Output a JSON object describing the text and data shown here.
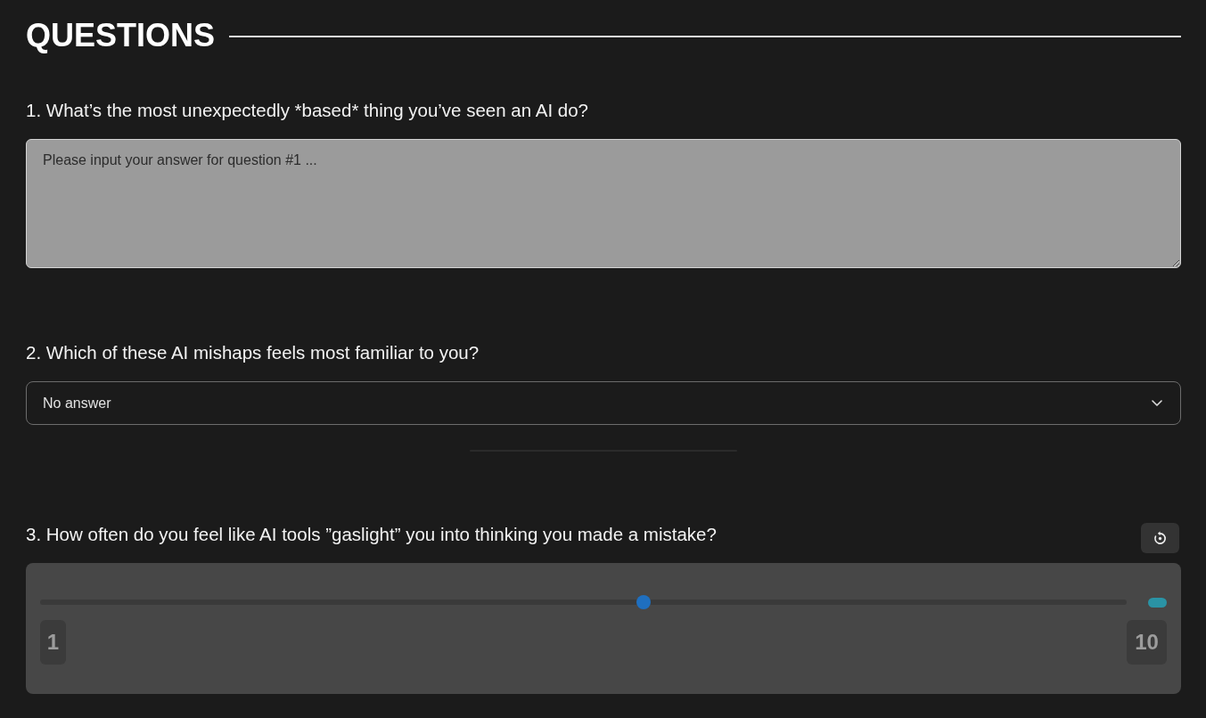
{
  "heading": "QUESTIONS",
  "questions": [
    {
      "kind": "text",
      "label": "1. What’s the most unexpectedly *based* thing you’ve seen an AI do?",
      "placeholder": "Please input your answer for question #1 ..."
    },
    {
      "kind": "select",
      "label": "2. Which of these AI mishaps feels most familiar to you?",
      "value": "No answer"
    },
    {
      "kind": "slider",
      "label": "3. How often do you feel like AI tools ”gaslight” you into thinking you made a mistake?",
      "level": 0.555,
      "min_label": "1",
      "max_label": "10"
    }
  ]
}
